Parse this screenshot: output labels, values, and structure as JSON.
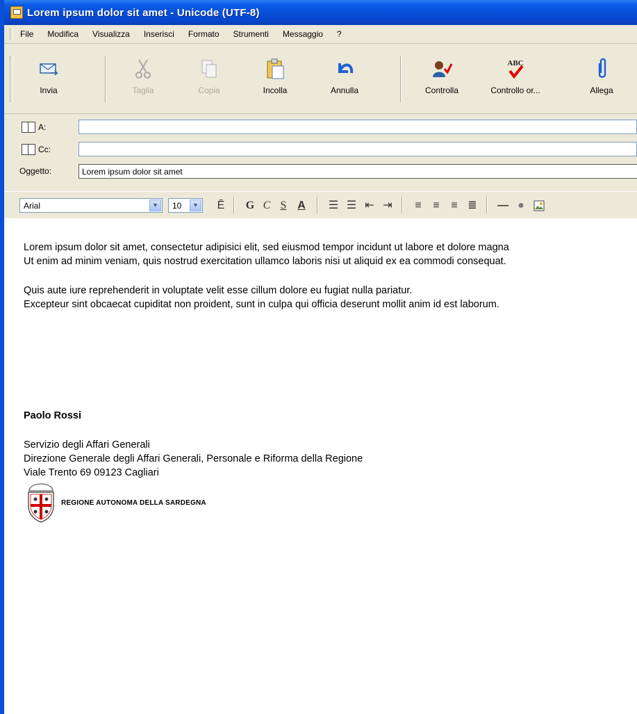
{
  "window": {
    "title": "Lorem ipsum dolor sit amet - Unicode (UTF-8)"
  },
  "menu": [
    "File",
    "Modifica",
    "Visualizza",
    "Inserisci",
    "Formato",
    "Strumenti",
    "Messaggio",
    "?"
  ],
  "toolbar": {
    "send": "Invia",
    "cut": "Taglia",
    "copy": "Copia",
    "paste": "Incolla",
    "undo": "Annulla",
    "check": "Controlla",
    "spell": "Controllo or...",
    "attach": "Allega",
    "spell_icon_text": "ABC"
  },
  "headers": {
    "to_label": "A:",
    "cc_label": "Cc:",
    "subject_label": "Oggetto:",
    "to_value": "",
    "cc_value": "",
    "subject_value": "Lorem ipsum dolor sit amet"
  },
  "format": {
    "font": "Arial",
    "size": "10",
    "bold": "G",
    "italic": "C",
    "underline": "S",
    "color": "A"
  },
  "body": {
    "line1": "Lorem ipsum dolor sit amet, consectetur adipisici elit, sed eiusmod tempor incidunt ut labore et dolore magna",
    "line2": "Ut enim ad minim veniam, quis nostrud exercitation ullamco laboris nisi ut aliquid ex ea commodi consequat.",
    "line3": "Quis aute iure reprehenderit in voluptate velit esse cillum dolore eu fugiat nulla pariatur.",
    "line4": "Excepteur sint obcaecat cupiditat non proident, sunt in culpa qui officia deserunt mollit anim id est laborum."
  },
  "signature": {
    "name": "Paolo Rossi",
    "office": "Servizio degli Affari Generali",
    "department": "Direzione Generale degli Affari Generali, Personale e Riforma della Regione",
    "address": "Viale Trento 69  09123 Cagliari",
    "logo_text": "REGIONE AUTONOMA DELLA SARDEGNA"
  },
  "colors": {
    "titlebar": "#0747cf",
    "window_bg": "#ece9d8",
    "undo_blue": "#1f5fd6",
    "spell_red": "#e00000"
  }
}
